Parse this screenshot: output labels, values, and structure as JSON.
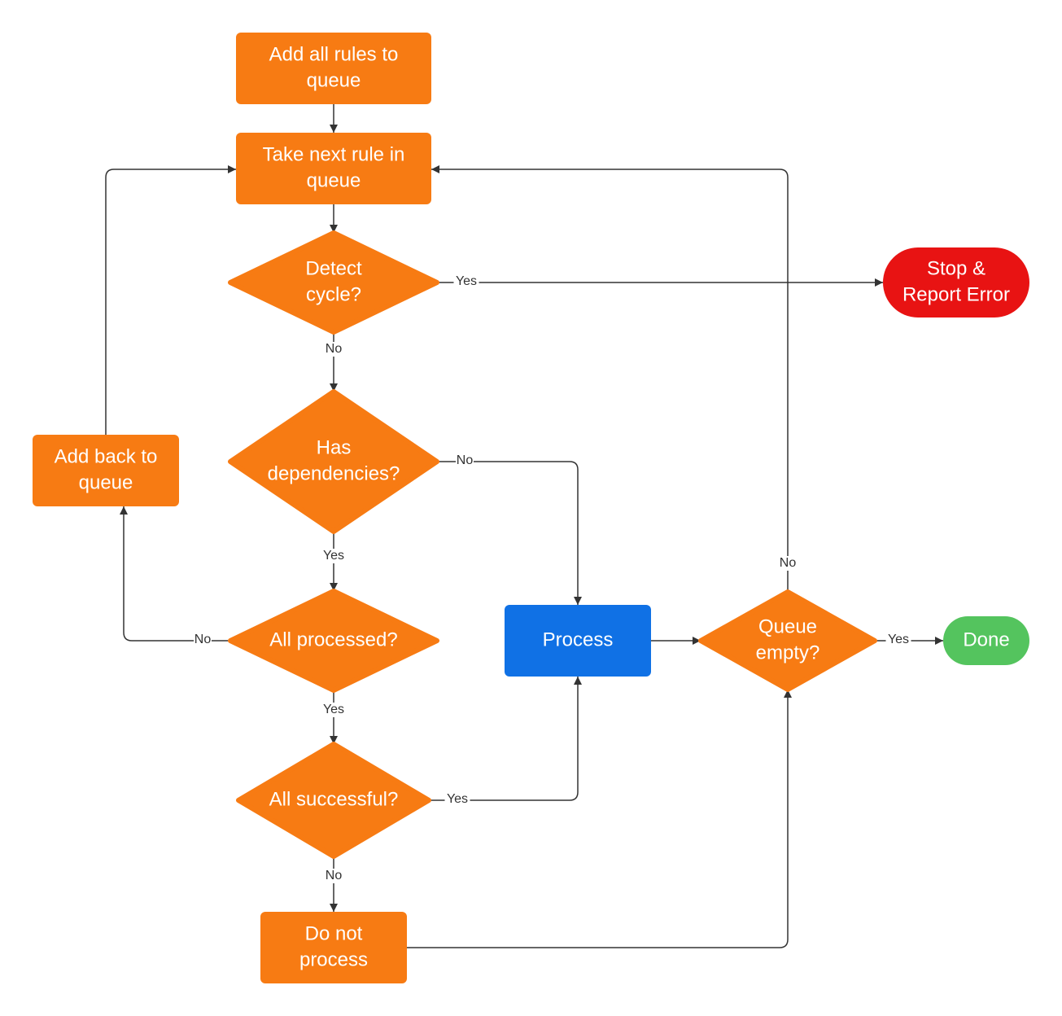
{
  "colors": {
    "process": "#f77b13",
    "action": "#1071e5",
    "error": "#e81313",
    "done": "#54c45e",
    "edge": "#333333"
  },
  "nodes": {
    "add_all": {
      "lines": [
        "Add all rules to",
        "queue"
      ],
      "shape": "rect",
      "color": "process"
    },
    "take_next": {
      "lines": [
        "Take next rule in",
        "queue"
      ],
      "shape": "rect",
      "color": "process"
    },
    "detect_cycle": {
      "lines": [
        "Detect",
        "cycle?"
      ],
      "shape": "diamond",
      "color": "process"
    },
    "stop_error": {
      "lines": [
        "Stop &",
        "Report Error"
      ],
      "shape": "terminal",
      "color": "error"
    },
    "has_deps": {
      "lines": [
        "Has",
        "dependencies?"
      ],
      "shape": "diamond",
      "color": "process"
    },
    "add_back": {
      "lines": [
        "Add back to",
        "queue"
      ],
      "shape": "rect",
      "color": "process"
    },
    "all_processed": {
      "lines": [
        "All processed?"
      ],
      "shape": "diamond",
      "color": "process"
    },
    "process": {
      "lines": [
        "Process"
      ],
      "shape": "rect",
      "color": "action"
    },
    "queue_empty": {
      "lines": [
        "Queue",
        "empty?"
      ],
      "shape": "diamond",
      "color": "process"
    },
    "done": {
      "lines": [
        "Done"
      ],
      "shape": "terminal",
      "color": "done"
    },
    "all_successful": {
      "lines": [
        "All successful?"
      ],
      "shape": "diamond",
      "color": "process"
    },
    "do_not_process": {
      "lines": [
        "Do not",
        "process"
      ],
      "shape": "rect",
      "color": "process"
    }
  },
  "edges": [
    {
      "from": "add_all",
      "to": "take_next",
      "label": ""
    },
    {
      "from": "take_next",
      "to": "detect_cycle",
      "label": ""
    },
    {
      "from": "detect_cycle",
      "to": "stop_error",
      "label": "Yes"
    },
    {
      "from": "detect_cycle",
      "to": "has_deps",
      "label": "No"
    },
    {
      "from": "has_deps",
      "to": "process",
      "label": "No"
    },
    {
      "from": "has_deps",
      "to": "all_processed",
      "label": "Yes"
    },
    {
      "from": "all_processed",
      "to": "add_back",
      "label": "No"
    },
    {
      "from": "add_back",
      "to": "take_next",
      "label": ""
    },
    {
      "from": "all_processed",
      "to": "all_successful",
      "label": "Yes"
    },
    {
      "from": "all_successful",
      "to": "process",
      "label": "Yes"
    },
    {
      "from": "all_successful",
      "to": "do_not_process",
      "label": "No"
    },
    {
      "from": "process",
      "to": "queue_empty",
      "label": ""
    },
    {
      "from": "do_not_process",
      "to": "queue_empty",
      "label": ""
    },
    {
      "from": "queue_empty",
      "to": "done",
      "label": "Yes"
    },
    {
      "from": "queue_empty",
      "to": "take_next",
      "label": "No"
    }
  ]
}
